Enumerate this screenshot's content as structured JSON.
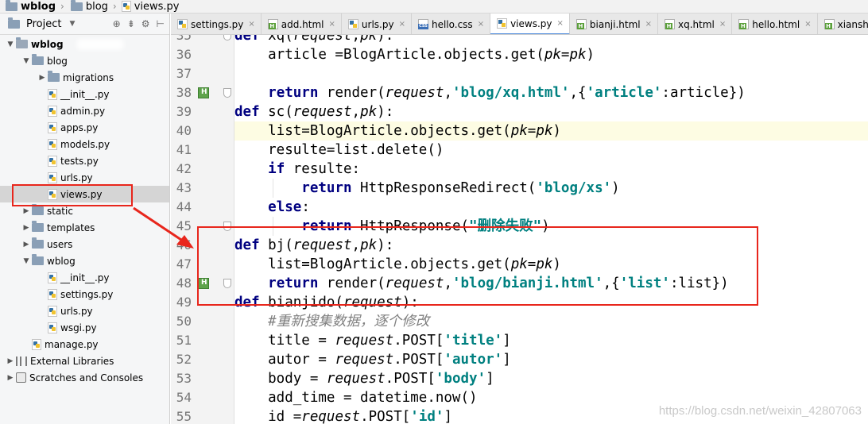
{
  "breadcrumb": {
    "items": [
      {
        "label": "wblog",
        "icon": "folder-icon"
      },
      {
        "label": "blog",
        "icon": "folder-icon"
      },
      {
        "label": "views.py",
        "icon": "python-file-icon"
      }
    ]
  },
  "project_panel": {
    "title": "Project",
    "tree": [
      {
        "label": "wblog",
        "level": 0,
        "kind": "project",
        "expanded": true
      },
      {
        "label": "blog",
        "level": 1,
        "kind": "folder",
        "expanded": true
      },
      {
        "label": "migrations",
        "level": 2,
        "kind": "folder",
        "expanded": false
      },
      {
        "label": "__init__.py",
        "level": 2,
        "kind": "py"
      },
      {
        "label": "admin.py",
        "level": 2,
        "kind": "py"
      },
      {
        "label": "apps.py",
        "level": 2,
        "kind": "py"
      },
      {
        "label": "models.py",
        "level": 2,
        "kind": "py"
      },
      {
        "label": "tests.py",
        "level": 2,
        "kind": "py"
      },
      {
        "label": "urls.py",
        "level": 2,
        "kind": "py"
      },
      {
        "label": "views.py",
        "level": 2,
        "kind": "py",
        "selected": true
      },
      {
        "label": "static",
        "level": 1,
        "kind": "folder",
        "expanded": false
      },
      {
        "label": "templates",
        "level": 1,
        "kind": "folder",
        "expanded": false
      },
      {
        "label": "users",
        "level": 1,
        "kind": "folder",
        "expanded": false
      },
      {
        "label": "wblog",
        "level": 1,
        "kind": "folder",
        "expanded": true
      },
      {
        "label": "__init__.py",
        "level": 2,
        "kind": "py"
      },
      {
        "label": "settings.py",
        "level": 2,
        "kind": "py"
      },
      {
        "label": "urls.py",
        "level": 2,
        "kind": "py"
      },
      {
        "label": "wsgi.py",
        "level": 2,
        "kind": "py"
      },
      {
        "label": "manage.py",
        "level": 1,
        "kind": "py"
      },
      {
        "label": "External Libraries",
        "level": 0,
        "kind": "lib",
        "expanded": false
      },
      {
        "label": "Scratches and Consoles",
        "level": 0,
        "kind": "scratch",
        "expanded": false
      }
    ]
  },
  "tabs": [
    {
      "label": "settings.py",
      "icon": "py"
    },
    {
      "label": "add.html",
      "icon": "html"
    },
    {
      "label": "urls.py",
      "icon": "py"
    },
    {
      "label": "hello.css",
      "icon": "css"
    },
    {
      "label": "views.py",
      "icon": "py",
      "active": true
    },
    {
      "label": "bianji.html",
      "icon": "html"
    },
    {
      "label": "xq.html",
      "icon": "html"
    },
    {
      "label": "hello.html",
      "icon": "html"
    },
    {
      "label": "xianshi.htm",
      "icon": "html"
    }
  ],
  "editor": {
    "lines": [
      {
        "n": "35",
        "code": "def xq(request,pk):"
      },
      {
        "n": "36",
        "code": "    article =BlogArticle.objects.get(pk=pk)"
      },
      {
        "n": "37",
        "code": ""
      },
      {
        "n": "38",
        "code": "    return render(request,'blog/xq.html',{'article':article})"
      },
      {
        "n": "39",
        "code": "def sc(request,pk):"
      },
      {
        "n": "40",
        "code": "    list=BlogArticle.objects.get(pk=pk)"
      },
      {
        "n": "41",
        "code": "    resulte=list.delete()"
      },
      {
        "n": "42",
        "code": "    if resulte:"
      },
      {
        "n": "43",
        "code": "        return HttpResponseRedirect('blog/xs')"
      },
      {
        "n": "44",
        "code": "    else:"
      },
      {
        "n": "45",
        "code": "        return HttpResponse(\"删除失败\")"
      },
      {
        "n": "46",
        "code": "def bj(request,pk):"
      },
      {
        "n": "47",
        "code": "    list=BlogArticle.objects.get(pk=pk)"
      },
      {
        "n": "48",
        "code": "    return render(request,'blog/bianji.html',{'list':list})"
      },
      {
        "n": "49",
        "code": "def bianjido(request):"
      },
      {
        "n": "50",
        "code": "    #重新搜集数据，逐个修改"
      },
      {
        "n": "51",
        "code": "    title = request.POST['title']"
      },
      {
        "n": "52",
        "code": "    autor = request.POST['autor']"
      },
      {
        "n": "53",
        "code": "    body = request.POST['body']"
      },
      {
        "n": "54",
        "code": "    add_time = datetime.now()"
      },
      {
        "n": "55",
        "code": "    id =request.POST['id']"
      }
    ]
  },
  "watermark": "https://blog.csdn.net/weixin_42807063",
  "colors": {
    "annotation": "#e8261c",
    "keyword": "#000080",
    "string": "#008080",
    "comment": "#808080",
    "current_line": "#fdfce3",
    "selection": "#d5d5d5"
  }
}
